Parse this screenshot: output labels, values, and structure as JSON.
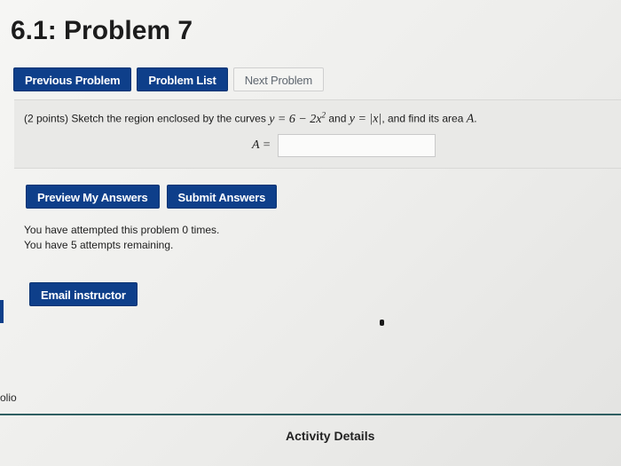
{
  "page": {
    "title": "6.1: Problem 7"
  },
  "nav": {
    "previous": "Previous Problem",
    "list": "Problem List",
    "next": "Next Problem"
  },
  "problem": {
    "points": "(2 points)",
    "intro": "Sketch the region enclosed by the curves",
    "curve1": "y = 6 − 2x",
    "curve1_exp": "2",
    "conj": "and",
    "curve2": "y = |x|",
    "outro": ", and find its area",
    "area_var": "A",
    "period": ".",
    "answer_label": "A =",
    "answer_value": ""
  },
  "actions": {
    "preview": "Preview My Answers",
    "submit": "Submit Answers"
  },
  "status": {
    "attempted": "You have attempted this problem 0 times.",
    "remaining": "You have 5 attempts remaining."
  },
  "email": {
    "label": "Email instructor"
  },
  "sidebar": {
    "folio": "olio"
  },
  "footer": {
    "activity_details": "Activity Details"
  },
  "colors": {
    "button_primary": "#0e3f8a",
    "footer_line": "#2f5f62"
  }
}
